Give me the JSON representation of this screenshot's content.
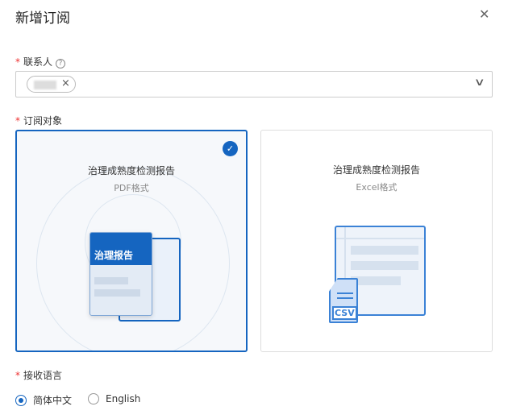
{
  "dialog": {
    "title": "新增订阅",
    "close_icon": "close-icon"
  },
  "contact": {
    "label": "联系人",
    "required": "*",
    "help": "?",
    "tag_close": "×"
  },
  "target": {
    "label": "订阅对象",
    "required": "*",
    "options": [
      {
        "title": "治理成熟度检测报告",
        "format": "PDF格式",
        "selected": true,
        "doc_title": "治理报告"
      },
      {
        "title": "治理成熟度检测报告",
        "format": "Excel格式",
        "selected": false,
        "badge": "CSV"
      }
    ],
    "check": "✓"
  },
  "language": {
    "label": "接收语言",
    "required": "*",
    "options": [
      {
        "label": "简体中文",
        "selected": true
      },
      {
        "label": "English",
        "selected": false
      }
    ]
  },
  "colors": {
    "accent": "#1565c0"
  }
}
